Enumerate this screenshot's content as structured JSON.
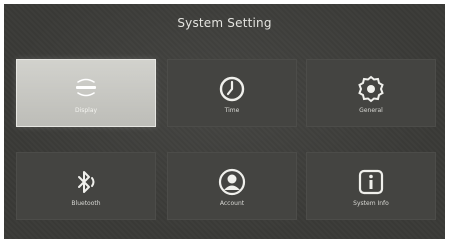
{
  "header": {
    "title": "System Setting"
  },
  "tiles": [
    {
      "label": "Display",
      "icon": "display-icon",
      "selected": true
    },
    {
      "label": "Time",
      "icon": "clock-icon"
    },
    {
      "label": "General",
      "icon": "gear-icon"
    },
    {
      "label": "Bluetooth",
      "icon": "bluetooth-icon"
    },
    {
      "label": "Account",
      "icon": "account-icon"
    },
    {
      "label": "System Info",
      "icon": "info-icon"
    }
  ],
  "colors": {
    "background": "#3a3a37",
    "tile": "#444441",
    "selected_tile": "#c8c8c3",
    "icon": "#f0f0ec"
  }
}
